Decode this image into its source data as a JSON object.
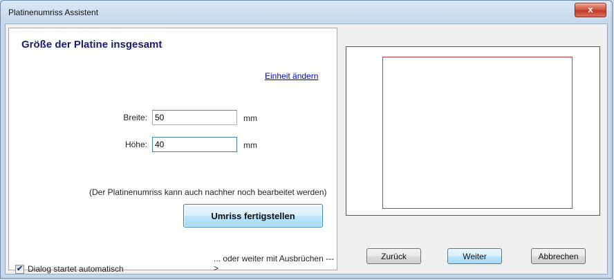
{
  "window": {
    "title": "Platinenumriss Assistent",
    "close_glyph": "x"
  },
  "left_panel": {
    "heading": "Größe der Platine insgesamt",
    "change_unit_link": "Einheit ändern",
    "width": {
      "label": "Breite:",
      "value": "50",
      "unit": "mm"
    },
    "height": {
      "label": "Höhe:",
      "value": "40",
      "unit": "mm"
    },
    "hint": "(Der Platinenumriss kann auch nachher noch bearbeitet werden)",
    "finish_button": "Umriss fertigstellen",
    "continue_hint": "... oder weiter mit Ausbrüchen --->",
    "autostart_checkbox": {
      "label": "Dialog startet automatisch",
      "checked": true,
      "glyph": "✔"
    }
  },
  "footer_buttons": {
    "back": "Zurück",
    "next": "Weiter",
    "cancel": "Abbrechen"
  },
  "colors": {
    "outline": "#d9323a",
    "heading": "#1a1a6e",
    "link": "#0000cc"
  }
}
